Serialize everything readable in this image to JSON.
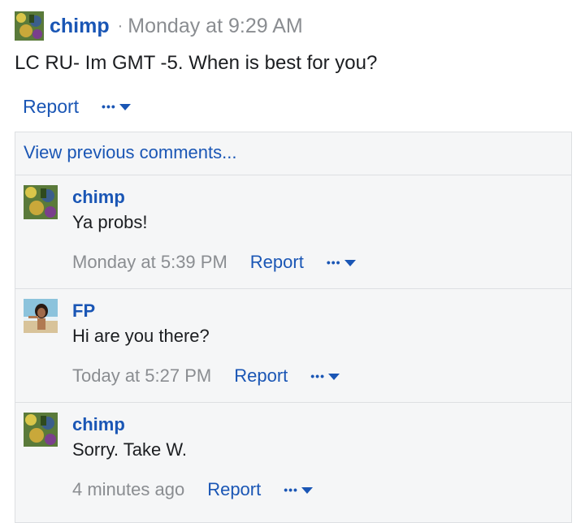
{
  "post": {
    "author": "chimp",
    "separator": "·",
    "time": "Monday at 9:29 AM",
    "text": "LC RU- Im GMT -5. When is best for you?",
    "report_label": "Report",
    "more_dots": "•••"
  },
  "comments_section": {
    "view_previous_label": "View previous comments...",
    "comments": [
      {
        "author": "chimp",
        "text": "Ya probs!",
        "time": "Monday at 5:39 PM",
        "report_label": "Report",
        "more_dots": "•••"
      },
      {
        "author": "FP",
        "text": "Hi are you there?",
        "time": "Today at 5:27 PM",
        "report_label": "Report",
        "more_dots": "•••"
      },
      {
        "author": "chimp",
        "text": "Sorry. Take W.",
        "time": "4 minutes ago",
        "report_label": "Report",
        "more_dots": "•••"
      }
    ]
  },
  "colors": {
    "link": "#1a56b5",
    "muted": "#8a8d91",
    "panel_bg": "#f5f6f7",
    "border": "#dddfe2"
  },
  "icons": {
    "more_menu": "chevron-down-icon",
    "avatar_chimp": "avatar",
    "avatar_fp": "avatar"
  }
}
